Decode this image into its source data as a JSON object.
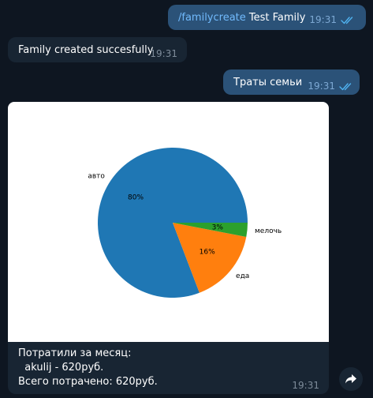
{
  "messages": [
    {
      "direction": "outgoing",
      "command": "/familycreate",
      "text": " Test Family",
      "time": "19:31",
      "status_icon": "double-check-icon"
    },
    {
      "direction": "incoming",
      "text": "Family created succesfully",
      "time": "19:31"
    },
    {
      "direction": "outgoing",
      "text": "Траты семьи",
      "time": "19:31",
      "status_icon": "double-check-icon"
    },
    {
      "direction": "incoming",
      "type": "photo",
      "caption": [
        "Потратили за месяц:",
        "  akulij - 620руб.",
        "Всего потрачено: 620руб."
      ],
      "time": "19:31"
    }
  ],
  "share_button_icon": "forward-arrow-icon",
  "colors": {
    "background": "#0e1621",
    "outgoing_bubble": "#2b5278",
    "incoming_bubble": "#182533",
    "command_link": "#71bafd",
    "check_marks": "#4fb2f0"
  },
  "chart_data": {
    "type": "pie",
    "categories": [
      "авто",
      "еда",
      "мелочь"
    ],
    "values": [
      80,
      16,
      3
    ],
    "value_labels": [
      "80%",
      "16%",
      "3%"
    ],
    "colors": [
      "#1f77b4",
      "#ff7f0e",
      "#2ca02c"
    ],
    "start_angle": 0,
    "direction": "counterclockwise"
  }
}
